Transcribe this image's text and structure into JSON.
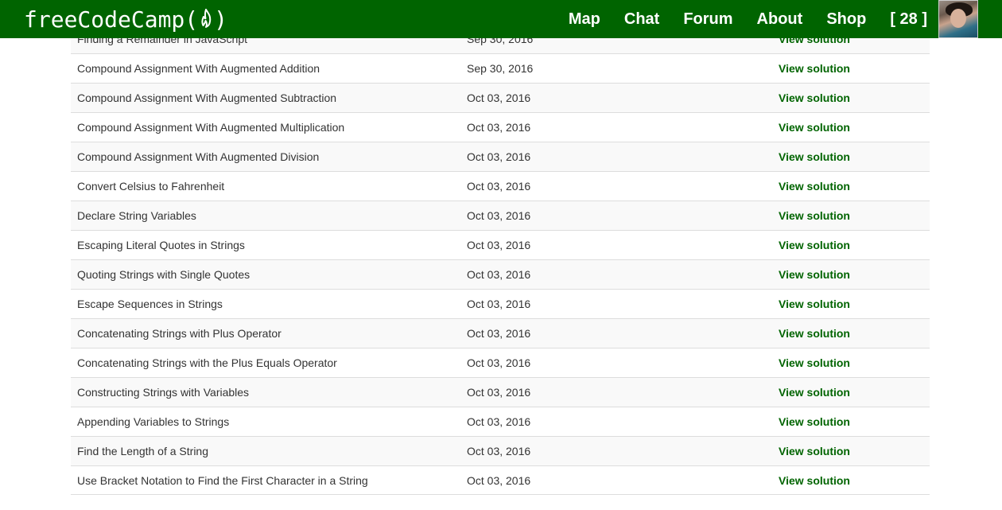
{
  "brand": {
    "text_left": "freeCodeCamp(",
    "text_right": ")",
    "icon": "flame-icon"
  },
  "nav": {
    "items": [
      "Map",
      "Chat",
      "Forum",
      "About",
      "Shop"
    ],
    "points": "[ 28 ]",
    "avatar": "user-avatar"
  },
  "colors": {
    "navbar": "#006400",
    "link": "#006400",
    "row_alt": "#f9f9f9",
    "border": "#dddddd"
  },
  "table": {
    "rows": [
      {
        "name": "Finding a Remainder in JavaScript",
        "date": "Sep 30, 2016",
        "link": "View solution"
      },
      {
        "name": "Compound Assignment With Augmented Addition",
        "date": "Sep 30, 2016",
        "link": "View solution"
      },
      {
        "name": "Compound Assignment With Augmented Subtraction",
        "date": "Oct 03, 2016",
        "link": "View solution"
      },
      {
        "name": "Compound Assignment With Augmented Multiplication",
        "date": "Oct 03, 2016",
        "link": "View solution"
      },
      {
        "name": "Compound Assignment With Augmented Division",
        "date": "Oct 03, 2016",
        "link": "View solution"
      },
      {
        "name": "Convert Celsius to Fahrenheit",
        "date": "Oct 03, 2016",
        "link": "View solution"
      },
      {
        "name": "Declare String Variables",
        "date": "Oct 03, 2016",
        "link": "View solution"
      },
      {
        "name": "Escaping Literal Quotes in Strings",
        "date": "Oct 03, 2016",
        "link": "View solution"
      },
      {
        "name": "Quoting Strings with Single Quotes",
        "date": "Oct 03, 2016",
        "link": "View solution"
      },
      {
        "name": "Escape Sequences in Strings",
        "date": "Oct 03, 2016",
        "link": "View solution"
      },
      {
        "name": "Concatenating Strings with Plus Operator",
        "date": "Oct 03, 2016",
        "link": "View solution"
      },
      {
        "name": "Concatenating Strings with the Plus Equals Operator",
        "date": "Oct 03, 2016",
        "link": "View solution"
      },
      {
        "name": "Constructing Strings with Variables",
        "date": "Oct 03, 2016",
        "link": "View solution"
      },
      {
        "name": "Appending Variables to Strings",
        "date": "Oct 03, 2016",
        "link": "View solution"
      },
      {
        "name": "Find the Length of a String",
        "date": "Oct 03, 2016",
        "link": "View solution"
      },
      {
        "name": "Use Bracket Notation to Find the First Character in a String",
        "date": "Oct 03, 2016",
        "link": "View solution"
      }
    ]
  }
}
